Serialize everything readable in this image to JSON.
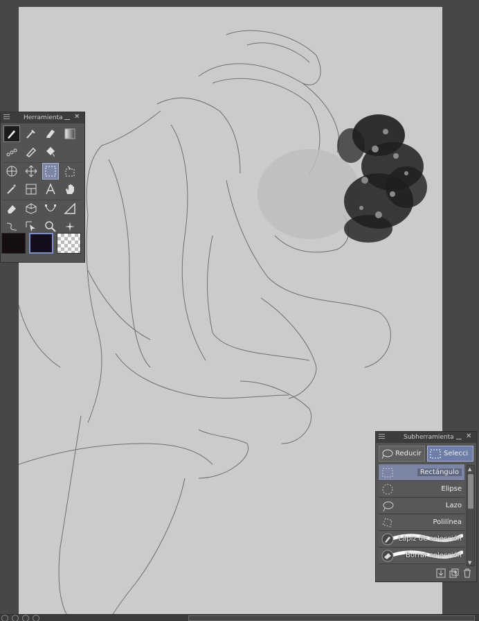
{
  "tool_palette": {
    "title": "Herramienta",
    "tools": [
      {
        "name": "pen-icon"
      },
      {
        "name": "eyedropper-icon"
      },
      {
        "name": "marker-icon"
      },
      {
        "name": "gradient-icon"
      },
      {
        "name": "decoration-icon"
      },
      {
        "name": "eraser-blend-icon"
      },
      {
        "name": "fill-bucket-icon"
      },
      {
        "name": "operation-icon"
      },
      {
        "name": "move-layer-icon"
      },
      {
        "name": "selection-icon"
      },
      {
        "name": "auto-select-icon"
      },
      {
        "name": "magic-wand-icon"
      },
      {
        "name": "frame-icon"
      },
      {
        "name": "text-icon"
      },
      {
        "name": "hand-icon"
      },
      {
        "name": "eraser-icon"
      },
      {
        "name": "3d-object-icon"
      },
      {
        "name": "bezier-icon"
      },
      {
        "name": "ruler-icon"
      },
      {
        "name": "correct-line-icon"
      },
      {
        "name": "object-select-icon"
      },
      {
        "name": "zoom-icon"
      },
      {
        "name": "sparkle-icon"
      }
    ],
    "active_tool": "selection-icon",
    "colors": {
      "main": "#150f13",
      "sub": "#130d1d",
      "transparent": "checker"
    }
  },
  "subtool_palette": {
    "title": "Subherramienta",
    "groups": [
      {
        "label": "Reducir",
        "active": false
      },
      {
        "label": "Selecci",
        "active": true
      }
    ],
    "items": [
      {
        "label": "Rectángulo",
        "active": true
      },
      {
        "label": "Elipse",
        "active": false
      },
      {
        "label": "Lazo",
        "active": false
      },
      {
        "label": "Polilínea",
        "active": false
      },
      {
        "label": "Lápiz de selección",
        "active": false
      },
      {
        "label": "Borrar selección",
        "active": false
      }
    ]
  },
  "colors": {
    "canvas": "#cbcbcb",
    "workspace": "#474747",
    "panel": "#535353",
    "accent": "#7b86a6"
  }
}
